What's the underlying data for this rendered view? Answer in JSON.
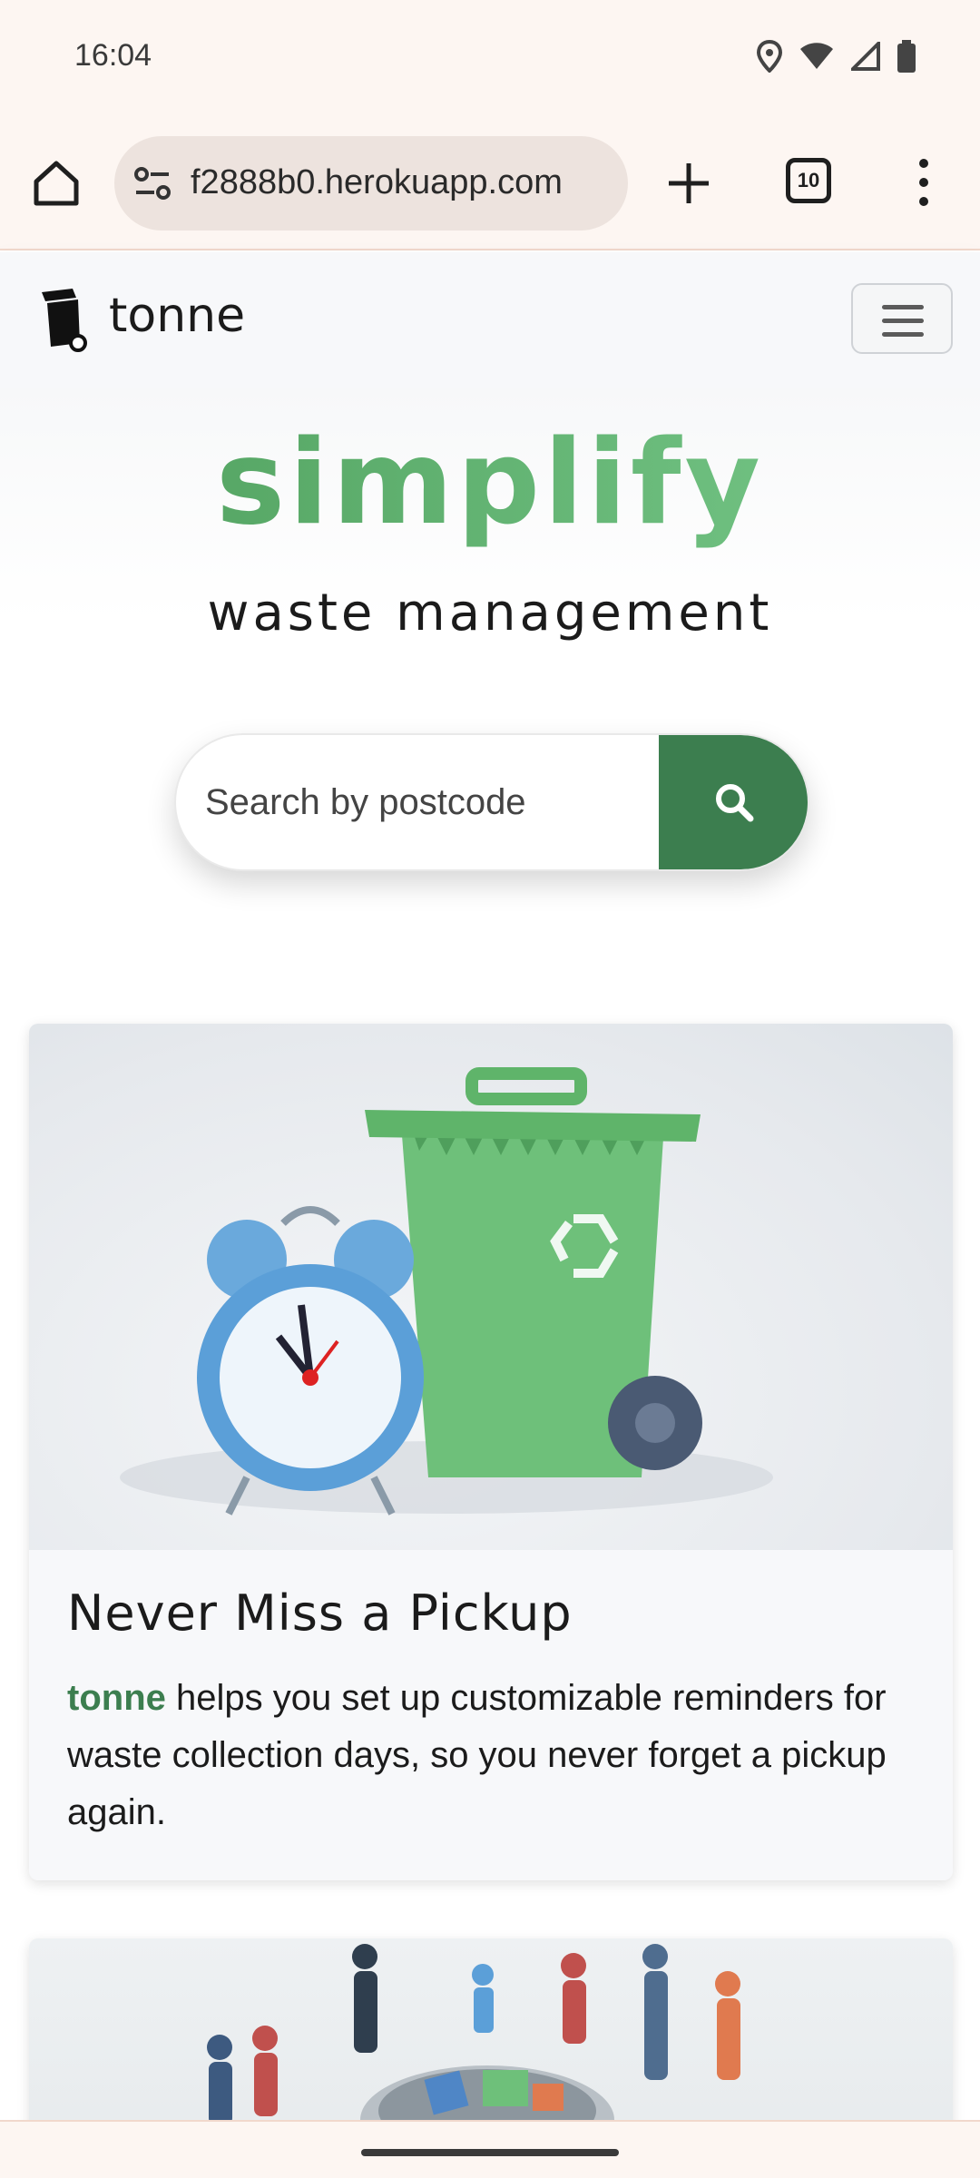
{
  "status_bar": {
    "time": "16:04",
    "icons": [
      "location-icon",
      "wifi-icon",
      "signal-icon",
      "battery-icon"
    ]
  },
  "browser": {
    "url": "f2888b0.herokuapp.com",
    "tab_count": "10",
    "icons": [
      "home-icon",
      "site-settings-icon",
      "new-tab-icon",
      "tabs-icon",
      "more-menu-icon"
    ]
  },
  "navbar": {
    "brand": "tonne",
    "brand_icon": "bin-logo-icon",
    "toggler_icon": "hamburger-menu-icon"
  },
  "hero": {
    "title": "simplify",
    "subtitle": "waste management",
    "search_placeholder": "Search by postcode",
    "search_icon": "search-icon"
  },
  "cards": [
    {
      "title": "Never Miss a Pickup",
      "brand": "tonne",
      "text": " helps you set up customizable reminders for waste collection days, so you never forget a pickup again."
    }
  ],
  "colors": {
    "accent_green": "#3c7e4f",
    "title_green": "#5fb46a",
    "browser_bg": "#fdf6f2"
  }
}
